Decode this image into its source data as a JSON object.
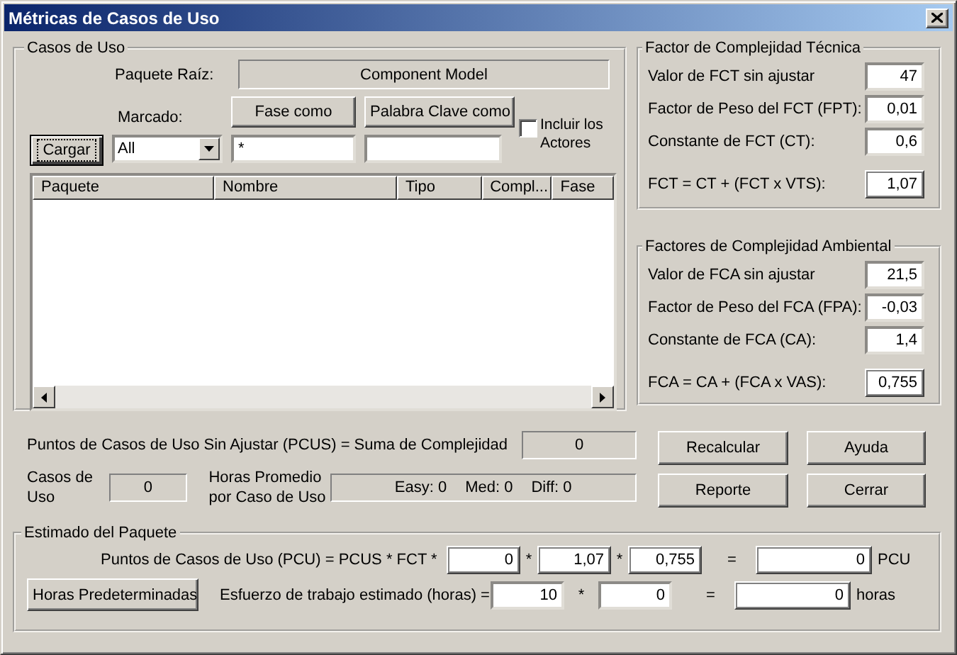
{
  "window": {
    "title": "Métricas de Casos de Uso"
  },
  "use_cases": {
    "title": "Casos de Uso",
    "root_package_label": "Paquete Raíz:",
    "root_package": "Component Model",
    "marked_label": "Marcado:",
    "marked_value": "All",
    "phase_button": "Fase como",
    "keyword_button": "Palabra Clave como",
    "phase_filter": "*",
    "include_actors": {
      "label": "Incluir los Actores",
      "checked": false
    },
    "load_button": "Cargar",
    "columns": [
      "Paquete",
      "Nombre",
      "Tipo",
      "Compl...",
      "Fase"
    ]
  },
  "tcf": {
    "title": "Factor de Complejidad Técnica",
    "rows": [
      {
        "label": "Valor de FCT sin ajustar",
        "value": "47",
        "kind": "input"
      },
      {
        "label": "Factor de Peso del FCT (FPT):",
        "value": "0,01",
        "kind": "input"
      },
      {
        "label": "Constante de FCT (CT):",
        "value": "0,6",
        "kind": "input"
      },
      {
        "label": "FCT = CT + (FCT x VTS):",
        "value": "1,07",
        "kind": "result"
      }
    ]
  },
  "ecf": {
    "title": "Factores de Complejidad Ambiental",
    "rows": [
      {
        "label": "Valor de FCA sin ajustar",
        "value": "21,5",
        "kind": "input"
      },
      {
        "label": "Factor de Peso del FCA (FPA):",
        "value": "-0,03",
        "kind": "input"
      },
      {
        "label": "Constante de FCA (CA):",
        "value": "1,4",
        "kind": "input"
      },
      {
        "label": "FCA  = CA + (FCA x VAS):",
        "value": "0,755",
        "kind": "result"
      }
    ]
  },
  "pcus": {
    "label": "Puntos de Casos de Uso Sin Ajustar (PCUS) = Suma de Complejidad",
    "value": "0"
  },
  "use_case_count": {
    "label": "Casos de Uso",
    "value": "0"
  },
  "avg_hours": {
    "label": "Horas Promedio por Caso de Uso",
    "values": [
      "Easy: 0",
      "Med: 0",
      "Diff: 0"
    ]
  },
  "buttons": [
    "Recalcular",
    "Ayuda",
    "Reporte",
    "Cerrar"
  ],
  "estimate": {
    "title": "Estimado del Paquete",
    "pcu": {
      "label": "Puntos de Casos de Uso (PCU) = PCUS * FCT *",
      "factors": [
        "0",
        "1,07",
        "0,755"
      ],
      "operators": [
        "*",
        "*"
      ],
      "equals": "=",
      "result": "0",
      "unit": "PCU"
    },
    "hours_button": "Horas Predeterminadas",
    "effort": {
      "label": "Esfuerzo de trabajo estimado (horas) =",
      "factors": [
        "10",
        "0"
      ],
      "operators": [
        "*"
      ],
      "equals": "=",
      "result": "0",
      "unit": "horas"
    }
  }
}
